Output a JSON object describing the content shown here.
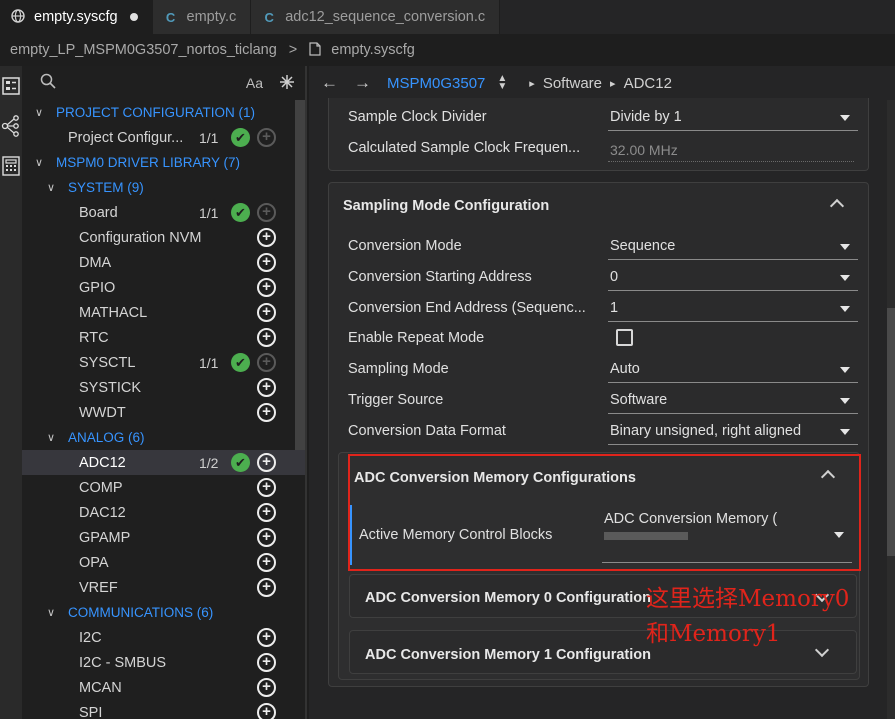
{
  "tabs": [
    {
      "icon": "globe-icon",
      "label": "empty.syscfg",
      "active": true,
      "modified": true
    },
    {
      "icon": "c-file-icon",
      "glyph": "C",
      "label": "empty.c",
      "active": false
    },
    {
      "icon": "c-file-icon",
      "glyph": "C",
      "label": "adc12_sequence_conversion.c",
      "active": false
    }
  ],
  "breadcrumb": {
    "project": "empty_LP_MSPM0G3507_nortos_ticlang",
    "file": "empty.syscfg"
  },
  "sidebar": {
    "search_placeholder": "",
    "match_case": "Aa",
    "tree": [
      {
        "label": "PROJECT CONFIGURATION (1)",
        "type": "category",
        "level": 0
      },
      {
        "label": "Project Configur...",
        "level": 1,
        "count": "1/1",
        "ok": true,
        "add_disabled": true
      },
      {
        "label": "MSPM0 DRIVER LIBRARY (7)",
        "type": "category",
        "level": 0
      },
      {
        "label": "SYSTEM (9)",
        "type": "category",
        "level": 1
      },
      {
        "label": "Board",
        "level": 2,
        "count": "1/1",
        "ok": true,
        "add_disabled": true
      },
      {
        "label": "Configuration NVM",
        "level": 2
      },
      {
        "label": "DMA",
        "level": 2
      },
      {
        "label": "GPIO",
        "level": 2
      },
      {
        "label": "MATHACL",
        "level": 2
      },
      {
        "label": "RTC",
        "level": 2
      },
      {
        "label": "SYSCTL",
        "level": 2,
        "count": "1/1",
        "ok": true,
        "add_disabled": true
      },
      {
        "label": "SYSTICK",
        "level": 2
      },
      {
        "label": "WWDT",
        "level": 2
      },
      {
        "label": "ANALOG (6)",
        "type": "category",
        "level": 1
      },
      {
        "label": "ADC12",
        "level": 2,
        "count": "1/2",
        "ok": true,
        "selected": true
      },
      {
        "label": "COMP",
        "level": 2
      },
      {
        "label": "DAC12",
        "level": 2
      },
      {
        "label": "GPAMP",
        "level": 2
      },
      {
        "label": "OPA",
        "level": 2
      },
      {
        "label": "VREF",
        "level": 2
      },
      {
        "label": "COMMUNICATIONS (6)",
        "type": "category",
        "level": 1
      },
      {
        "label": "I2C",
        "level": 2
      },
      {
        "label": "I2C - SMBUS",
        "level": 2
      },
      {
        "label": "MCAN",
        "level": 2
      },
      {
        "label": "SPI",
        "level": 2
      }
    ]
  },
  "main": {
    "nav": {
      "device": "MSPM0G3507",
      "path1": "Software",
      "path2": "ADC12"
    },
    "clock": {
      "divider_label": "Sample Clock Divider",
      "divider_value": "Divide by 1",
      "calc_label": "Calculated Sample Clock Frequen...",
      "calc_value": "32.00 MHz"
    },
    "sampling": {
      "title": "Sampling Mode Configuration",
      "fields": [
        {
          "label": "Conversion Mode",
          "value": "Sequence",
          "kind": "select"
        },
        {
          "label": "Conversion Starting Address",
          "value": "0",
          "kind": "select"
        },
        {
          "label": "Conversion End Address (Sequenc...",
          "value": "1",
          "kind": "select"
        },
        {
          "label": "Enable Repeat Mode",
          "value": false,
          "kind": "checkbox"
        },
        {
          "label": "Sampling Mode",
          "value": "Auto",
          "kind": "select"
        },
        {
          "label": "Trigger Source",
          "value": "Software",
          "kind": "select"
        },
        {
          "label": "Conversion Data Format",
          "value": "Binary unsigned, right aligned",
          "kind": "select"
        }
      ]
    },
    "memory": {
      "title": "ADC Conversion Memory Configurations",
      "active_label": "Active Memory Control Blocks",
      "active_value": "ADC Conversion Memory (",
      "mem0_title": "ADC Conversion Memory 0 Configuration",
      "mem1_title": "ADC Conversion Memory 1 Configuration"
    },
    "annotation_line1": "这里选择Memory0",
    "annotation_line2": "和Memory1"
  },
  "colors": {
    "accent": "#3794ff",
    "ok": "#4cae4f",
    "highlight": "#e0241b"
  }
}
